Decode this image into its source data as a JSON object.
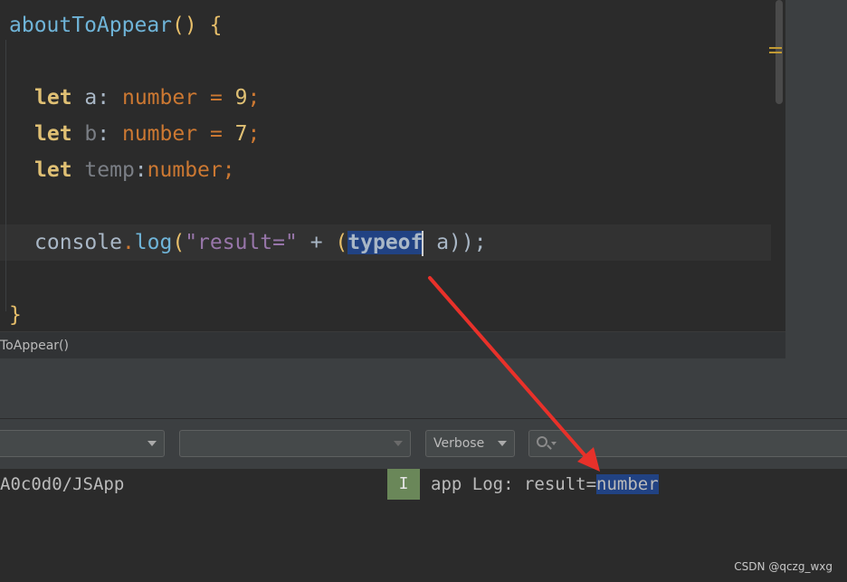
{
  "editor": {
    "lines": {
      "l1": {
        "fn": "aboutToAppear",
        "parens": "()",
        "brace": "{"
      },
      "l2": {
        "kw": "let",
        "var": "a",
        "colon": ":",
        "type": "number",
        "eq": "=",
        "value": "9",
        "semi": ";"
      },
      "l3": {
        "kw": "let",
        "var": "b",
        "colon": ":",
        "type": "number",
        "eq": "=",
        "value": "7",
        "semi": ";"
      },
      "l4": {
        "kw": "let",
        "var": "temp",
        "colon": ":",
        "type": "number",
        "semi": ";"
      },
      "l5": {
        "obj": "console",
        "dot": ".",
        "method": "log",
        "open": "(",
        "str": "\"result=\"",
        "plus": "+",
        "open2": "(",
        "typeof_a": "typ",
        "typeof_b": "eof",
        "rest": " a));"
      },
      "l6": {
        "brace": "}"
      }
    }
  },
  "breadcrumb": {
    "text": "ToAppear()"
  },
  "filters": {
    "device_combo": "",
    "process_combo": "",
    "level_combo": "Verbose"
  },
  "log": {
    "tag": "A0c0d0/JSApp",
    "level_badge": "I",
    "message_prefix": "app Log: result=",
    "message_value": "number"
  },
  "watermark": "CSDN @qczg_wxg",
  "colors": {
    "selection": "#214283",
    "info_badge": "#6a8759",
    "annotation_arrow": "#e8312a"
  }
}
